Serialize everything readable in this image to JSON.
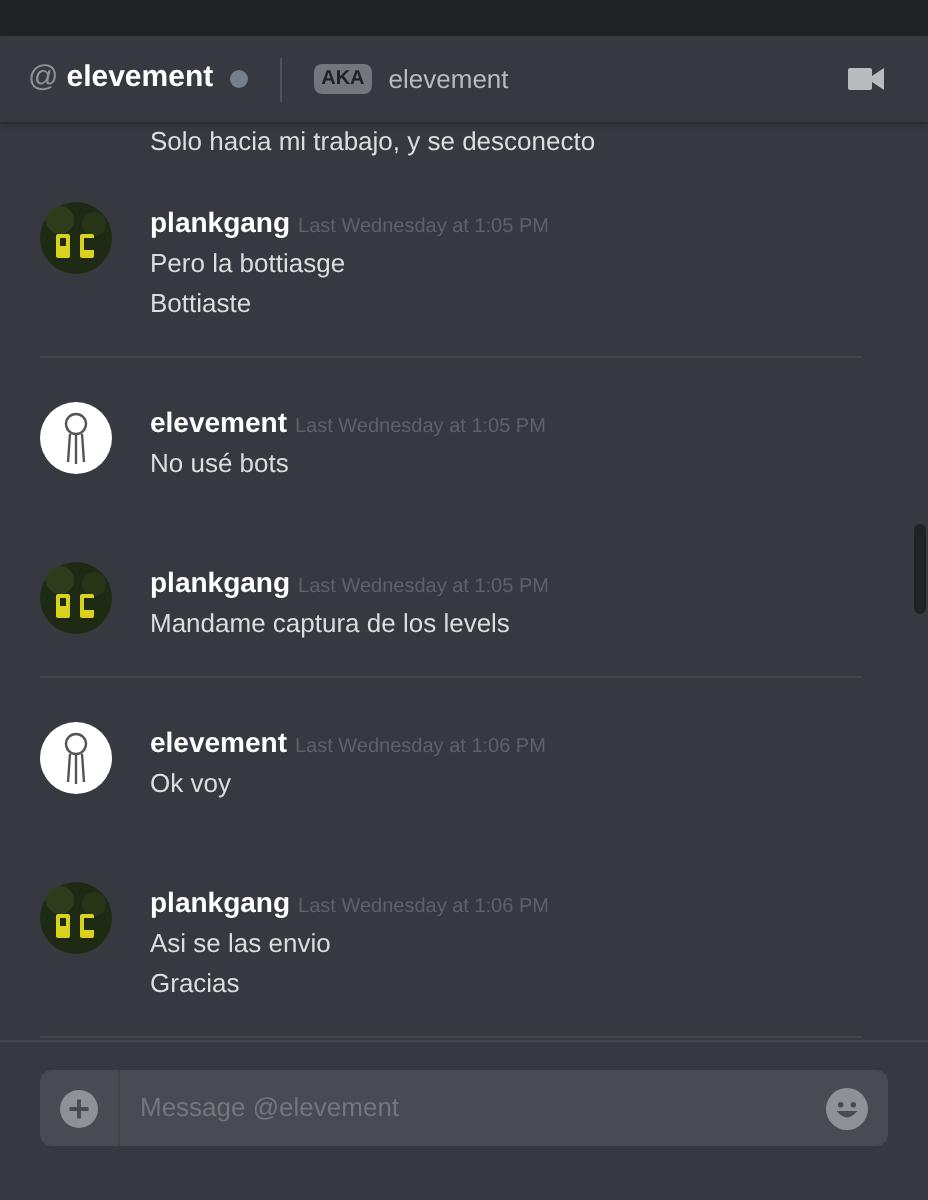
{
  "header": {
    "at": "@",
    "name": "elevement",
    "online": false,
    "aka_badge": "AKA",
    "aka_name": "elevement"
  },
  "partial_line": "Solo hacia mi trabajo, y se desconecto",
  "groups": [
    {
      "author": "plankgang",
      "kind": "pg",
      "timestamp": "Last Wednesday at 1:05 PM",
      "lines": [
        "Pero la bottiasge",
        "Bottiaste"
      ],
      "divider": true
    },
    {
      "author": "elevement",
      "kind": "sketch",
      "timestamp": "Last Wednesday at 1:05 PM",
      "lines": [
        "No usé bots"
      ],
      "divider": false
    },
    {
      "author": "plankgang",
      "kind": "pg",
      "timestamp": "Last Wednesday at 1:05 PM",
      "lines": [
        "Mandame captura de los levels"
      ],
      "divider": true
    },
    {
      "author": "elevement",
      "kind": "sketch",
      "timestamp": "Last Wednesday at 1:06 PM",
      "lines": [
        "Ok voy"
      ],
      "divider": false
    },
    {
      "author": "plankgang",
      "kind": "pg",
      "timestamp": "Last Wednesday at 1:06 PM",
      "lines": [
        "Asi se las envio",
        "Gracias"
      ],
      "divider": true
    }
  ],
  "composer": {
    "placeholder": "Message @elevement"
  }
}
